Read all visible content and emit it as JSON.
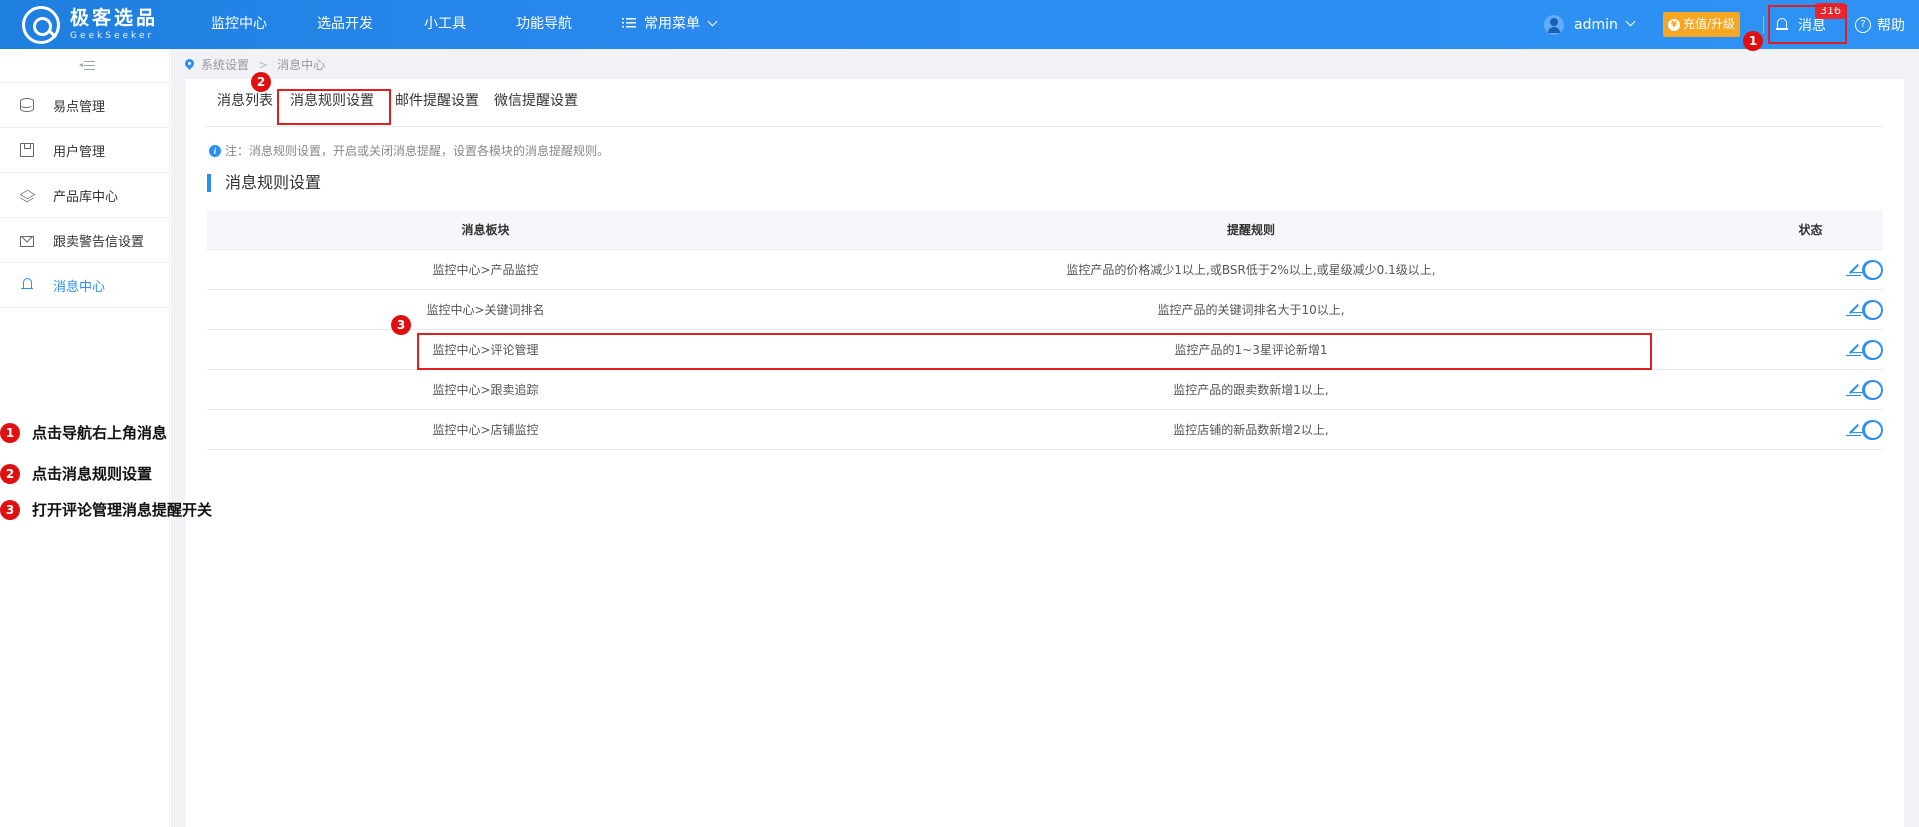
{
  "header": {
    "logo_cn": "极客选品",
    "logo_en": "GeekSeeker",
    "nav": [
      "监控中心",
      "选品开发",
      "小工具",
      "功能导航",
      "常用菜单"
    ],
    "user": "admin",
    "recharge_label": "充值/升级",
    "message_label": "消息",
    "message_count": "316",
    "help_label": "帮助"
  },
  "sidebar": {
    "items": [
      {
        "label": "易点管理",
        "icon": "database-icon"
      },
      {
        "label": "用户管理",
        "icon": "box-icon"
      },
      {
        "label": "产品库中心",
        "icon": "layers-icon"
      },
      {
        "label": "跟卖警告信设置",
        "icon": "mail-icon"
      },
      {
        "label": "消息中心",
        "icon": "bell-icon",
        "active": true
      }
    ]
  },
  "breadcrumb": [
    "系统设置",
    "消息中心"
  ],
  "tabs": [
    "消息列表",
    "消息规则设置",
    "邮件提醒设置",
    "微信提醒设置"
  ],
  "note": "注：消息规则设置，开启或关闭消息提醒，设置各模块的消息提醒规则。",
  "section_title": "消息规则设置",
  "table": {
    "headers": [
      "消息板块",
      "提醒规则",
      "状态"
    ],
    "rows": [
      {
        "module": "监控中心>产品监控",
        "rule": "监控产品的价格减少1以上,或BSR低于2%以上,或星级减少0.1级以上,",
        "enabled": true
      },
      {
        "module": "监控中心>关键词排名",
        "rule": "监控产品的关键词排名大于10以上,",
        "enabled": true
      },
      {
        "module": "监控中心>评论管理",
        "rule": "监控产品的1~3星评论新增1",
        "enabled": true
      },
      {
        "module": "监控中心>跟卖追踪",
        "rule": "监控产品的跟卖数新增1以上,",
        "enabled": true
      },
      {
        "module": "监控中心>店铺监控",
        "rule": "监控店铺的新品数新增2以上,",
        "enabled": true
      }
    ]
  },
  "annotations": {
    "markers": [
      "1",
      "2",
      "3"
    ],
    "steps": [
      {
        "num": "1",
        "text": "点击导航右上角消息"
      },
      {
        "num": "2",
        "text": "点击消息规则设置"
      },
      {
        "num": "3",
        "text": "打开评论管理消息提醒开关"
      }
    ]
  },
  "colors": {
    "primary": "#2b8ef0",
    "annotation": "#e02020",
    "recharge": "#f5a623",
    "badge": "#e9262e"
  }
}
